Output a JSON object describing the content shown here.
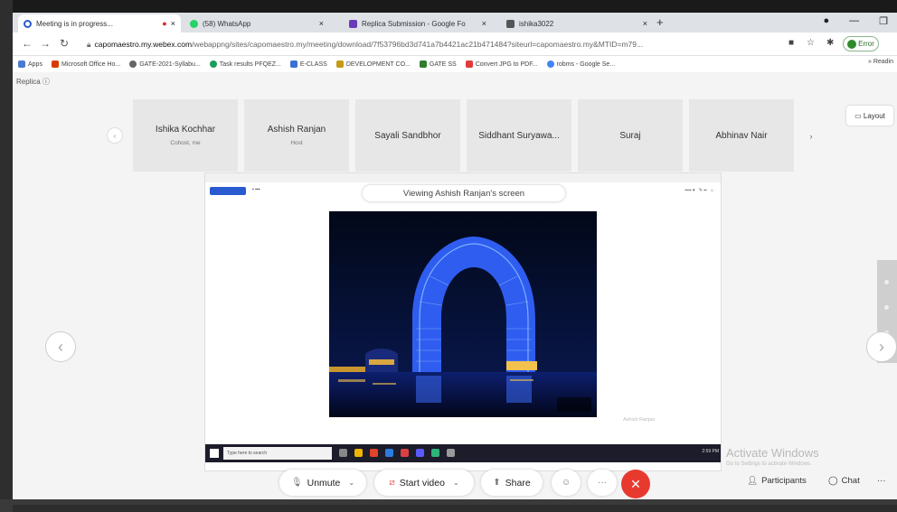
{
  "browser": {
    "tabs": [
      {
        "label": "Meeting is in progress...",
        "icon": "webex-icon",
        "color": "#2a5ad0",
        "close": "×"
      },
      {
        "label": "(58) WhatsApp",
        "icon": "whatsapp-icon",
        "color": "#25d366",
        "close": "×"
      },
      {
        "label": "Replica Submission - Google Fo",
        "icon": "forms-icon",
        "color": "#673ab7",
        "close": "×"
      },
      {
        "label": "ishika3022",
        "icon": "doc-icon",
        "color": "#555555",
        "close": "×"
      }
    ],
    "newtab": "+",
    "url_domain": "capomaestro.my.webex.com",
    "url_rest": "/webappng/sites/capomaestro.my/meeting/download/7f53796bd3d741a7b4421ac21b471484?siteurl=capomaestro.my&MTID=m79...",
    "error_label": "Error",
    "bookmarks": [
      "Apps",
      "Microsoft Office Ho...",
      "GATE-2021-Syllabu...",
      "Task results PFQEZ...",
      "E-CLASS",
      "DEVELOPMENT CO...",
      "GATE SS",
      "Convert JPG to PDF...",
      "robms - Google Se..."
    ],
    "bookmarks_right": "Readin"
  },
  "webex": {
    "replicas_label": "Replica",
    "layout_label": "Layout",
    "participants": [
      {
        "name": "Ishika Kochhar",
        "role": "Cohost, me"
      },
      {
        "name": "Ashish Ranjan",
        "role": "Host"
      },
      {
        "name": "Sayali Sandbhor",
        "role": ""
      },
      {
        "name": "Siddhant Suryawa...",
        "role": ""
      },
      {
        "name": "Suraj",
        "role": ""
      },
      {
        "name": "Abhinav Nair",
        "role": ""
      }
    ],
    "viewing_label": "Viewing Ashish Ranjan's screen",
    "shared_presenter": "Ashish Ranjan",
    "activate_title": "Activate Windows",
    "activate_sub": "Go to Settings to activate Windows.",
    "controls": {
      "unmute": "Unmute",
      "start_video": "Start video",
      "share": "Share",
      "more": "···",
      "end": "✕",
      "participants": "Participants",
      "chat": "Chat",
      "overflow": "···"
    },
    "taskbar_search": "Type here to search",
    "taskbar_time": "2:59 PM"
  }
}
